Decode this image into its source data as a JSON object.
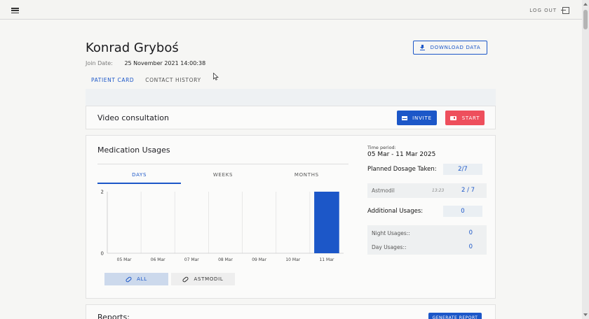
{
  "topbar": {
    "logout_label": "LOG OUT"
  },
  "patient": {
    "name": "Konrad Gryboś",
    "join_label": "Join Date:",
    "join_date": "25 November 2021 14:00:38"
  },
  "actions": {
    "download_label": "DOWNLOAD DATA"
  },
  "tabs": [
    {
      "label": "PATIENT CARD",
      "active": true
    },
    {
      "label": "CONTACT HISTORY",
      "active": false
    }
  ],
  "video": {
    "title": "Video consultation",
    "invite_label": "INVITE",
    "start_label": "START"
  },
  "medication": {
    "title": "Medication Usages",
    "period_tabs": [
      "DAYS",
      "WEEKS",
      "MONTHS"
    ],
    "active_period": "DAYS",
    "filters": {
      "all_label": "ALL",
      "astmodil_label": "ASTMODIL"
    },
    "time_period_label": "Time period:",
    "time_period_value": "05 Mar - 11 Mar 2025",
    "planned_label": "Planned Dosage Taken:",
    "planned_value": "2/7",
    "med_name": "Astmodil",
    "med_time": "13:23",
    "med_count": "2 / 7",
    "additional_label": "Additional Usages:",
    "additional_value": "0",
    "night_label": "Night Usages::",
    "night_value": "0",
    "day_label": "Day Usages::",
    "day_value": "0"
  },
  "chart_data": {
    "type": "bar",
    "categories": [
      "05 Mar",
      "06 Mar",
      "07 Mar",
      "08 Mar",
      "09 Mar",
      "10 Mar",
      "11 Mar"
    ],
    "values": [
      0,
      0,
      0,
      0,
      0,
      0,
      2
    ],
    "yticks": [
      "0",
      "2"
    ],
    "ylim": [
      0,
      2
    ],
    "bar_color": "#1c57c8"
  },
  "reports": {
    "title": "Reports:",
    "generate_label": "GENERATE REPORT"
  },
  "colors": {
    "accent": "#1c57c8",
    "danger": "#ee4f5c"
  }
}
